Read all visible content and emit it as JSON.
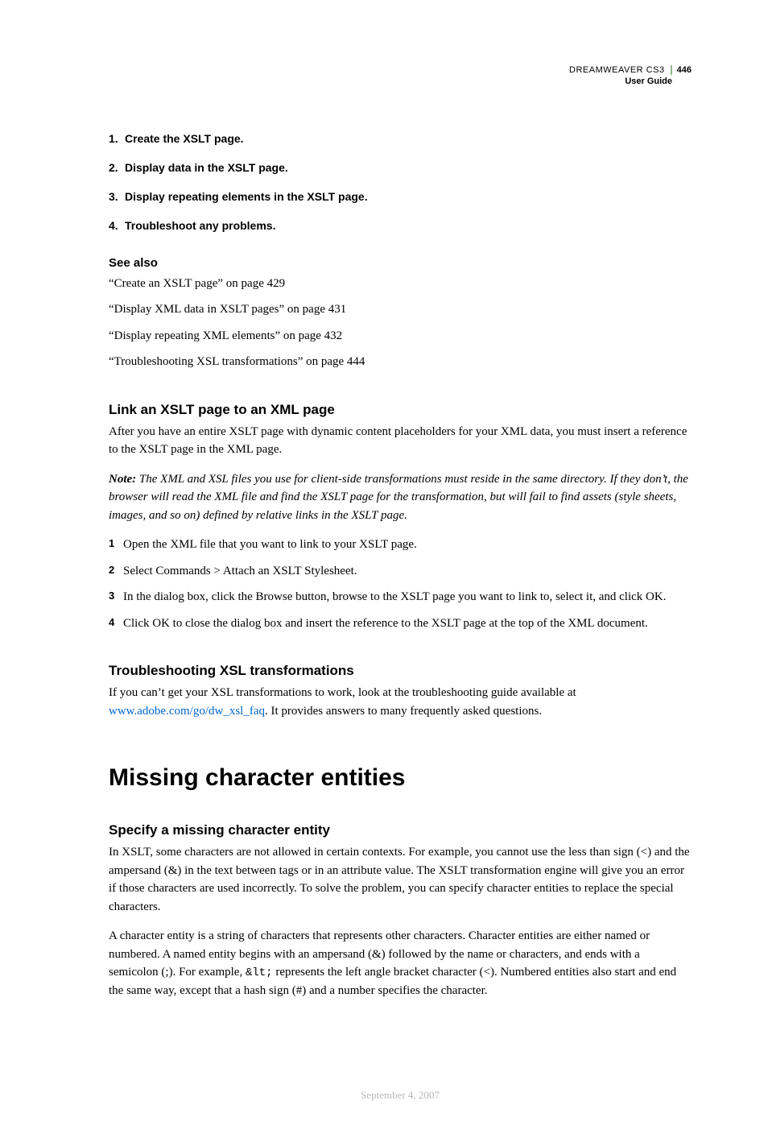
{
  "header": {
    "product": "DREAMWEAVER CS3",
    "page_number": "446",
    "guide": "User Guide"
  },
  "top_steps": [
    "Create the XSLT page.",
    "Display data in the XSLT page.",
    "Display repeating elements in the XSLT page.",
    "Troubleshoot any problems."
  ],
  "see_also": {
    "heading": "See also",
    "items": [
      "“Create an XSLT page” on page 429",
      "“Display XML data in XSLT pages” on page 431",
      "“Display repeating XML elements” on page 432",
      "“Troubleshooting XSL transformations” on page 444"
    ]
  },
  "link_section": {
    "heading": "Link an XSLT page to an XML page",
    "intro": "After you have an entire XSLT page with dynamic content placeholders for your XML data, you must insert a reference to the XSLT page in the XML page.",
    "note_label": "Note:",
    "note_body": " The XML and XSL files you use for client-side transformations must reside in the same directory. If they don’t, the browser will read the XML file and find the XSLT page for the transformation, but will fail to find assets (style sheets, images, and so on) defined by relative links in the XSLT page.",
    "steps": [
      "Open the XML file that you want to link to your XSLT page.",
      "Select Commands > Attach an XSLT Stylesheet.",
      "In the dialog box, click the Browse button, browse to the XSLT page you want to link to, select it, and click OK.",
      "Click OK to close the dialog box and insert the reference to the XSLT page at the top of the XML document."
    ]
  },
  "troubleshoot": {
    "heading": "Troubleshooting XSL transformations",
    "body_before": "If you can’t get your XSL transformations to work, look at the troubleshooting guide available at ",
    "link": "www.adobe.com/go/dw_xsl_faq",
    "body_after": ". It provides answers to many frequently asked questions."
  },
  "big_heading": "Missing character entities",
  "specify": {
    "heading": "Specify a missing character entity",
    "p1": "In XSLT, some characters are not allowed in certain contexts. For example, you cannot use the less than sign (<) and the ampersand (&) in the text between tags or in an attribute value. The XSLT transformation engine will give you an error if those characters are used incorrectly. To solve the problem, you can specify character entities to replace the special characters.",
    "p2_a": "A character entity is a string of characters that represents other characters. Character entities are either named or numbered. A named entity begins with an ampersand (&) followed by the name or characters, and ends with a semicolon (;). For example, ",
    "p2_code": "&lt;",
    "p2_b": " represents the left angle bracket character (<). Numbered entities also start and end the same way, except that a hash sign (#) and a number specifies the character."
  },
  "footer_date": "September 4, 2007"
}
